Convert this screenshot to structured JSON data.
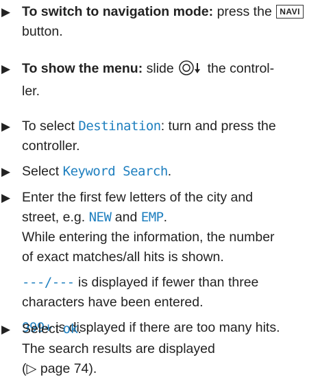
{
  "steps": [
    {
      "bold": "To switch to navigation mode:",
      "pre": " press the ",
      "key": "NAVI",
      "post": " button."
    },
    {
      "bold": "To show the menu:",
      "pre": " slide ",
      "post": " the control-",
      "post2": "ler."
    },
    {
      "pre": "To select ",
      "disp": "Destination",
      "post": ": turn and press the",
      "post2": "controller."
    },
    {
      "pre": "Select ",
      "disp": "Keyword Search",
      "post": "."
    },
    {
      "line1": "Enter the first few letters of the city and",
      "line2_pre": "street, e.g. ",
      "disp1": "NEW",
      "mid": " and ",
      "disp2": "EMP",
      "end": ".",
      "line3": "While entering the information, the number",
      "line4": "of exact matches/all hits is shown."
    },
    {
      "disp": "---/---",
      "post": " is displayed if fewer than three",
      "post2": "characters have been entered."
    },
    {
      "disp": "999+",
      "post": " is displayed if there are too many hits."
    },
    {
      "pre": "Select ",
      "disp": "ok",
      "post": ".",
      "line2": "The search results are displayed",
      "line3": "(▷ page 74)."
    }
  ],
  "icons": {
    "bullet": "▶",
    "controller": "controller-slide-down-icon"
  }
}
